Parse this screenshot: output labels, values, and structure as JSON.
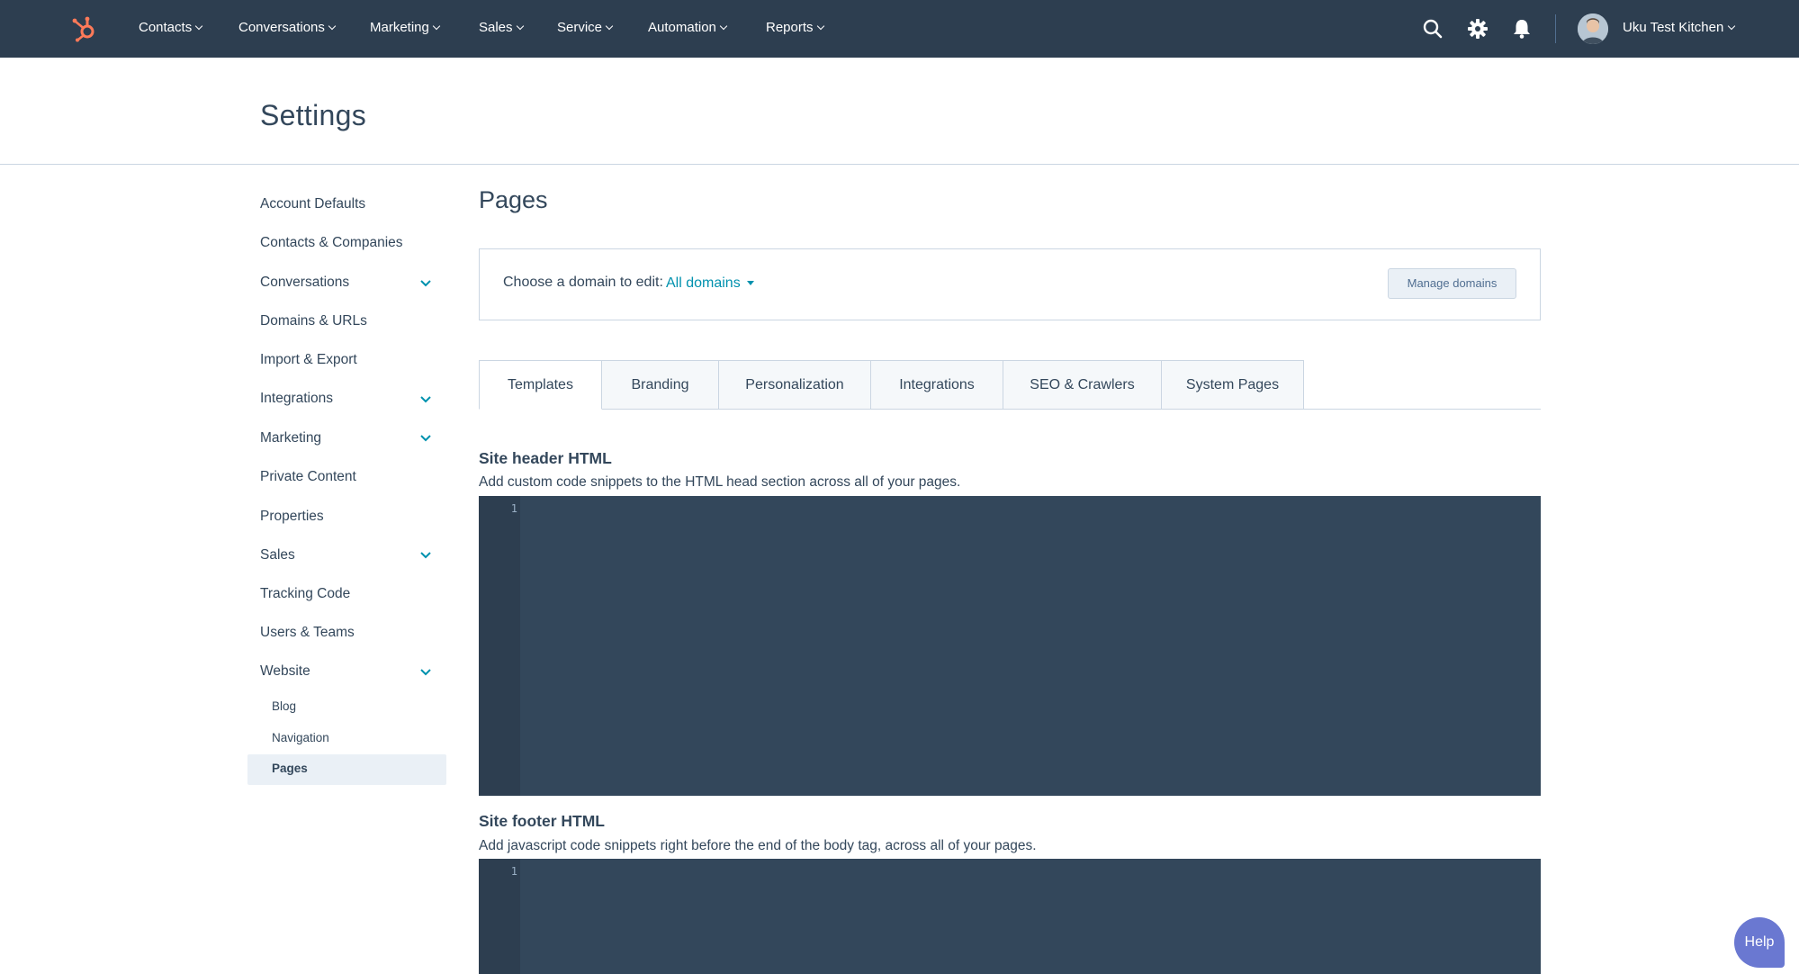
{
  "topnav": {
    "items": [
      {
        "label": "Contacts"
      },
      {
        "label": "Conversations"
      },
      {
        "label": "Marketing"
      },
      {
        "label": "Sales"
      },
      {
        "label": "Service"
      },
      {
        "label": "Automation"
      },
      {
        "label": "Reports"
      }
    ],
    "account_name": "Uku Test Kitchen",
    "icons": [
      "sprocket-logo-icon",
      "search-icon",
      "gear-icon",
      "bell-icon"
    ]
  },
  "header": {
    "title": "Settings"
  },
  "sidebar": {
    "items": [
      {
        "label": "Account Defaults"
      },
      {
        "label": "Contacts & Companies"
      },
      {
        "label": "Conversations"
      },
      {
        "label": "Domains & URLs"
      },
      {
        "label": "Import & Export"
      },
      {
        "label": "Integrations"
      },
      {
        "label": "Marketing"
      },
      {
        "label": "Private Content"
      },
      {
        "label": "Properties"
      },
      {
        "label": "Sales"
      },
      {
        "label": "Tracking Code"
      },
      {
        "label": "Users & Teams"
      },
      {
        "label": "Website"
      }
    ],
    "website_sub": [
      {
        "label": "Blog"
      },
      {
        "label": "Navigation"
      },
      {
        "label": "Pages"
      }
    ],
    "active": "Pages"
  },
  "main": {
    "title": "Pages",
    "domain": {
      "label": "Choose a domain to edit:",
      "selected": "All domains",
      "manage_label": "Manage domains"
    },
    "tabs": [
      {
        "label": "Templates"
      },
      {
        "label": "Branding"
      },
      {
        "label": "Personalization"
      },
      {
        "label": "Integrations"
      },
      {
        "label": "SEO & Crawlers"
      },
      {
        "label": "System Pages"
      }
    ],
    "active_tab": "Templates",
    "header_section": {
      "title": "Site header HTML",
      "desc": "Add custom code snippets to the HTML head section across all of your pages.",
      "line_no": "1"
    },
    "footer_section": {
      "title": "Site footer HTML",
      "desc": "Add javascript code snippets right before the end of the body tag, across all of your pages.",
      "line_no": "1"
    }
  },
  "help": {
    "label": "Help"
  },
  "colors": {
    "nav_bg": "#2d3e50",
    "text": "#33475b",
    "link": "#0091ae",
    "editor_bg": "#33475b",
    "brand_orange": "#ff7a59",
    "help_bg": "#6a78d1"
  }
}
